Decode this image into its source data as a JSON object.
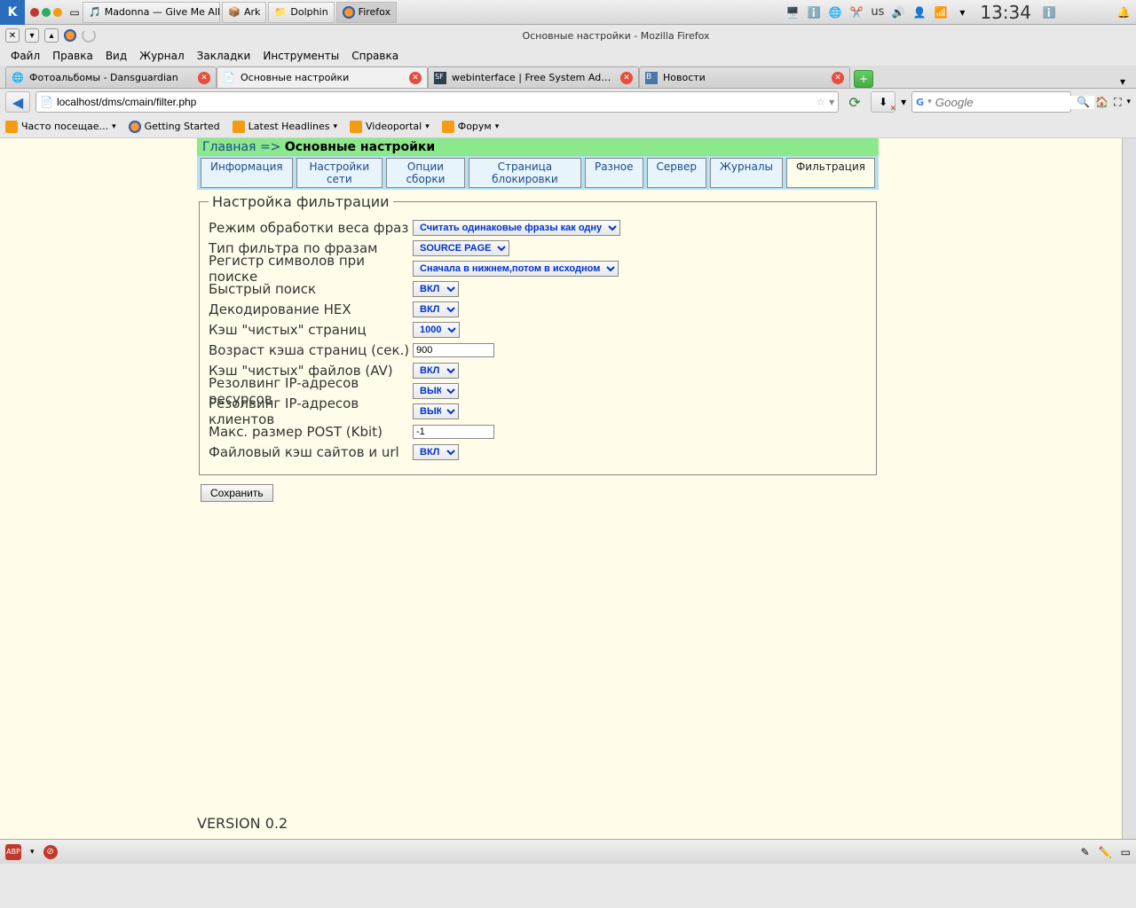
{
  "system_panel": {
    "tasks": [
      {
        "label": "Madonna — Give Me All Yo"
      },
      {
        "label": "Ark"
      },
      {
        "label": "Dolphin"
      },
      {
        "label": "Firefox"
      }
    ],
    "keyboard_layout": "us",
    "clock": "13:34"
  },
  "firefox": {
    "title": "Основные настройки - Mozilla Firefox",
    "menubar": [
      "Файл",
      "Правка",
      "Вид",
      "Журнал",
      "Закладки",
      "Инструменты",
      "Справка"
    ],
    "tabs": [
      {
        "label": "Фотоальбомы - Dansguardian",
        "active": false
      },
      {
        "label": "Основные настройки",
        "active": true
      },
      {
        "label": "webinterface | Free System Administr...",
        "active": false
      },
      {
        "label": "Новости",
        "active": false
      }
    ],
    "url": "localhost/dms/cmain/filter.php",
    "search_placeholder": "Google",
    "bookmarks": [
      "Часто посещае...",
      "Getting Started",
      "Latest Headlines",
      "Videoportal",
      "Форум"
    ]
  },
  "page": {
    "breadcrumb": {
      "home": "Главная",
      "sep": "=>",
      "current": "Основные настройки"
    },
    "nav_tabs": [
      "Информация",
      "Настройки сети",
      "Опции сборки",
      "Страница блокировки",
      "Разное",
      "Сервер",
      "Журналы",
      "Фильтрация"
    ],
    "active_tab": "Фильтрация",
    "fieldset_legend": "Настройка фильтрации",
    "rows": {
      "phrase_weight": {
        "label": "Режим обработки веса фраз",
        "value": "Считать одинаковые фразы как одну"
      },
      "filter_type": {
        "label": "Тип фильтра по фразам",
        "value": "SOURCE PAGE"
      },
      "case_mode": {
        "label": "Регистр символов при поиске",
        "value": "Сначала в нижнем,потом в исходном"
      },
      "quick_search": {
        "label": "Быстрый поиск",
        "value": "ВКЛ"
      },
      "hex_decode": {
        "label": "Декодирование HEX",
        "value": "ВКЛ"
      },
      "clean_cache": {
        "label": "Кэш \"чистых\" страниц",
        "value": "1000"
      },
      "cache_age": {
        "label": "Возраст кэша страниц (сек.)",
        "value": "900"
      },
      "clean_files": {
        "label": "Кэш \"чистых\" файлов (AV)",
        "value": "ВКЛ"
      },
      "resolve_res": {
        "label": "Резолвинг IP-адресов ресурсов",
        "value": "ВЫКЛ"
      },
      "resolve_cli": {
        "label": "Резолвинг IP-адресов клиентов",
        "value": "ВЫКЛ"
      },
      "post_max": {
        "label": "Макс. размер POST (Kbit)",
        "value": "-1"
      },
      "file_cache": {
        "label": "Файловый кэш сайтов и url",
        "value": "ВКЛ"
      }
    },
    "save_button": "Сохранить",
    "version": "VERSION 0.2"
  }
}
